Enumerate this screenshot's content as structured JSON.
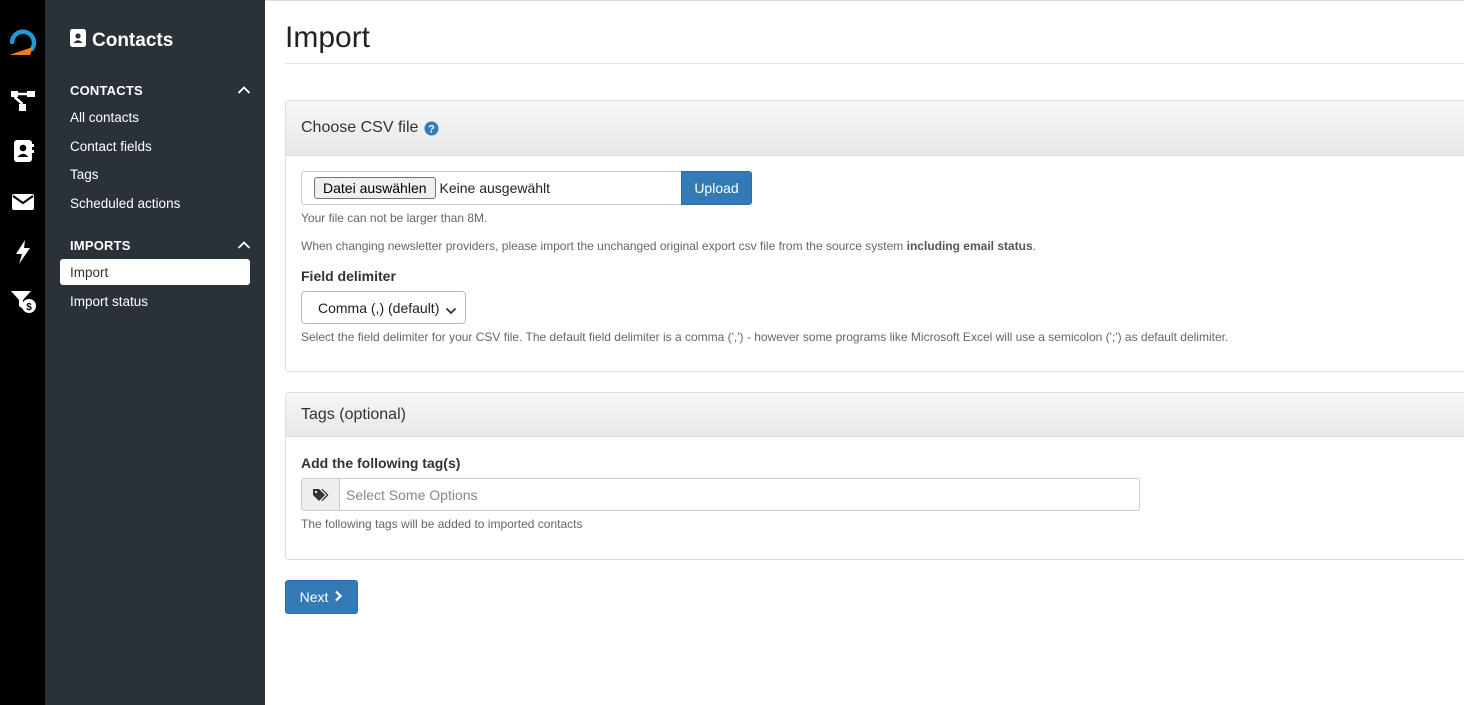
{
  "rail": {
    "icons": [
      "logo-icon",
      "sitemap-icon",
      "address-book-icon",
      "envelope-icon",
      "bolt-icon",
      "filter-dollar-icon"
    ]
  },
  "sidebar": {
    "title": "Contacts",
    "sections": [
      {
        "label": "CONTACTS",
        "items": [
          {
            "label": "All contacts",
            "active": false
          },
          {
            "label": "Contact fields",
            "active": false
          },
          {
            "label": "Tags",
            "active": false
          },
          {
            "label": "Scheduled actions",
            "active": false
          }
        ]
      },
      {
        "label": "IMPORTS",
        "items": [
          {
            "label": "Import",
            "active": true
          },
          {
            "label": "Import status",
            "active": false
          }
        ]
      }
    ]
  },
  "page": {
    "title": "Import"
  },
  "csv_panel": {
    "heading": "Choose CSV file",
    "file_button": "Datei auswählen",
    "file_status": "Keine ausgewählt",
    "upload_label": "Upload",
    "size_help": "Your file can not be larger than 8M.",
    "provider_help_start": "When changing newsletter providers, please import the unchanged original export csv file from the source system ",
    "provider_help_bold": "including email status",
    "provider_help_end": ".",
    "delimiter_label": "Field delimiter",
    "delimiter_value": "Comma (,) (default)",
    "delimiter_help": "Select the field delimiter for your CSV file. The default field delimiter is a comma (',') - however some programs like Microsoft Excel will use a semicolon (';') as default delimiter."
  },
  "tags_panel": {
    "heading": "Tags (optional)",
    "label": "Add the following tag(s)",
    "placeholder": "Select Some Options",
    "help": "The following tags will be added to imported contacts"
  },
  "actions": {
    "next_label": "Next"
  },
  "colors": {
    "primary": "#337ab7",
    "sidebar_bg": "#2b3138",
    "rail_bg": "#000000",
    "logo_blue": "#1e9ad6",
    "logo_orange": "#f07c1a"
  }
}
